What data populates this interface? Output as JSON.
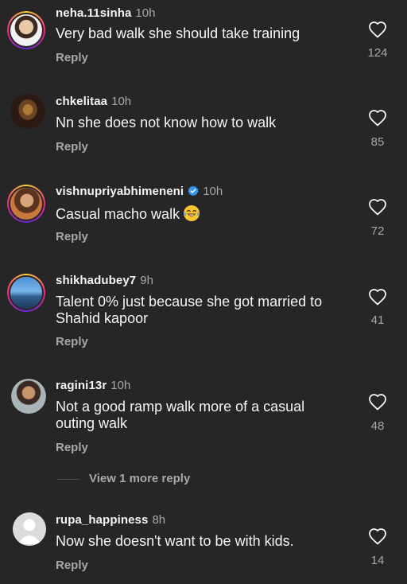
{
  "comments": [
    {
      "username": "neha.11sinha",
      "time": "10h",
      "text": "Very bad walk she should take training",
      "reply_label": "Reply",
      "likes": "124",
      "verified": false
    },
    {
      "username": "chkelitaa",
      "time": "10h",
      "text": "Nn she does not know how to walk",
      "reply_label": "Reply",
      "likes": "85",
      "verified": false
    },
    {
      "username": "vishnupriyabhimeneni",
      "time": "10h",
      "text": "Casual macho walk",
      "reply_label": "Reply",
      "likes": "72",
      "verified": true,
      "emoji": "laughing-tears-emoji"
    },
    {
      "username": "shikhadubey7",
      "time": "9h",
      "text": "Talent 0% just because she got married to Shahid kapoor",
      "reply_label": "Reply",
      "likes": "41",
      "verified": false
    },
    {
      "username": "ragini13r",
      "time": "10h",
      "text": "Not a good ramp walk more of a casual outing walk",
      "reply_label": "Reply",
      "likes": "48",
      "verified": false
    },
    {
      "username": "rupa_happiness",
      "time": "8h",
      "text": "Now she doesn't want to be with kids.",
      "reply_label": "Reply",
      "likes": "14",
      "verified": false
    }
  ],
  "view_more_replies": "View 1 more reply",
  "colors": {
    "background": "#262626",
    "primary_text": "#f5f5f5",
    "secondary_text": "#a8a8a8",
    "verified_blue": "#3897f0"
  },
  "icons": {
    "like": "heart-outline-icon",
    "verified": "verified-badge-icon"
  }
}
